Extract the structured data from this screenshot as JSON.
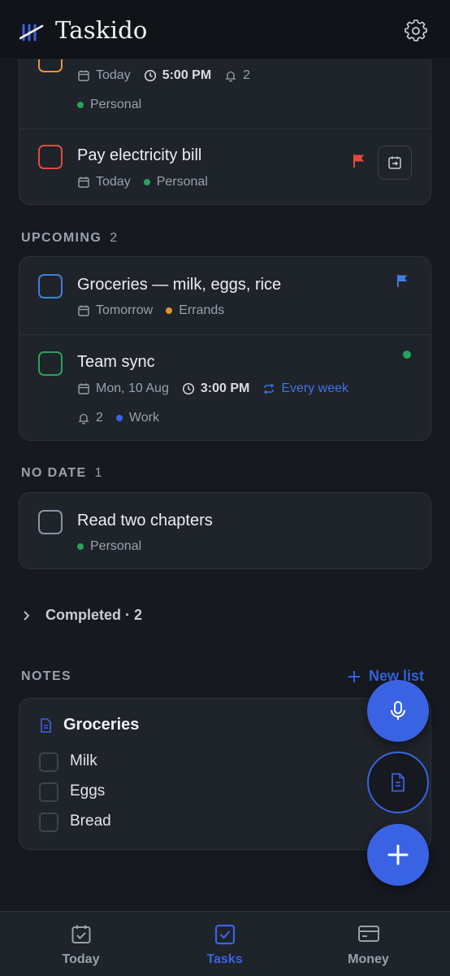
{
  "app": {
    "title": "Taskido"
  },
  "today_tasks": [
    {
      "date": "Today",
      "time": "5:00 PM",
      "reminders": "2",
      "list": "Personal",
      "list_color": "#27a35a",
      "checkbox_color": "#e8943a"
    },
    {
      "title": "Pay electricity bill",
      "date": "Today",
      "list": "Personal",
      "list_color": "#27a35a",
      "checkbox_color": "#e04a3c",
      "flag_color": "#e04a3c"
    }
  ],
  "upcoming": {
    "label": "UPCOMING",
    "count": "2",
    "tasks": [
      {
        "title": "Groceries — milk, eggs, rice",
        "date": "Tomorrow",
        "list": "Errands",
        "list_color": "#e0942f",
        "checkbox_color": "#3f7fe0",
        "flag_color": "#3f7fe0"
      },
      {
        "title": "Team sync",
        "date": "Mon, 10 Aug",
        "time": "3:00 PM",
        "repeat": "Every week",
        "reminders": "2",
        "list": "Work",
        "list_color": "#3a63e3",
        "checkbox_color": "#27a35a",
        "status_dot_color": "#27a35a"
      }
    ]
  },
  "no_date": {
    "label": "NO DATE",
    "count": "1",
    "tasks": [
      {
        "title": "Read two chapters",
        "list": "Personal",
        "list_color": "#27a35a",
        "checkbox_color": "#8a93a6"
      }
    ]
  },
  "completed": {
    "label": "Completed · 2"
  },
  "notes": {
    "label": "NOTES",
    "new_list_label": "New list",
    "card": {
      "title": "Groceries",
      "items": [
        "Milk",
        "Eggs",
        "Bread"
      ]
    }
  },
  "bottom_nav": [
    {
      "label": "Today",
      "icon": "calendar-check-icon",
      "active": false
    },
    {
      "label": "Tasks",
      "icon": "checkbox-icon",
      "active": true
    },
    {
      "label": "Money",
      "icon": "card-icon",
      "active": false
    }
  ],
  "colors": {
    "accent": "#3a63e3",
    "background": "#16191f",
    "card": "#1f232a"
  }
}
